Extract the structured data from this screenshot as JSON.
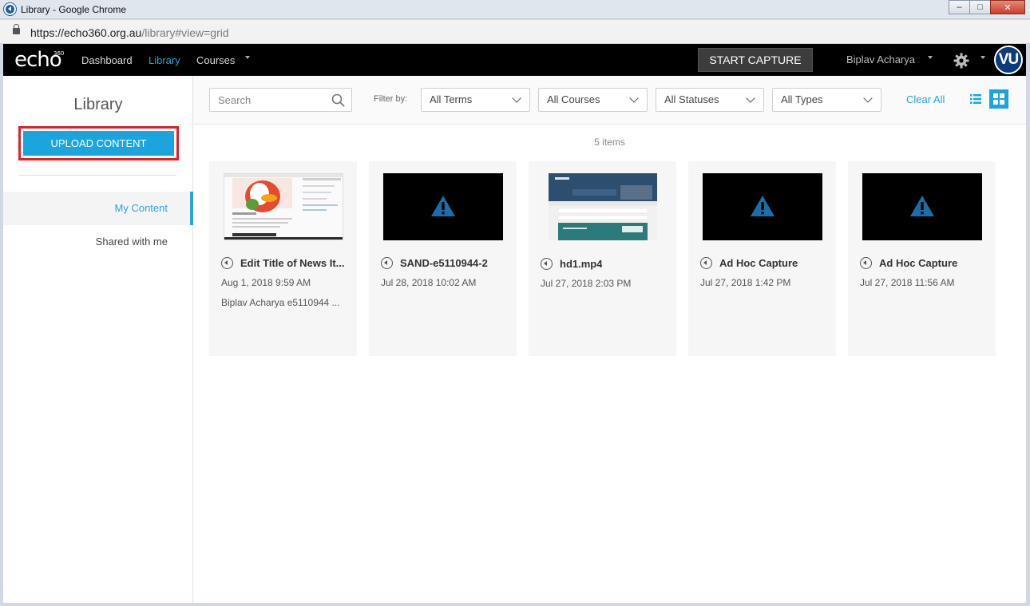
{
  "window": {
    "title": "Library - Google Chrome",
    "url_host": "https://echo360.org.au",
    "url_path": "/library#view=grid"
  },
  "nav": {
    "logo": "echo",
    "logo_sup": "360",
    "links": [
      "Dashboard",
      "Library",
      "Courses"
    ],
    "active": "Library",
    "start_capture": "START CAPTURE",
    "user_name": "Biplav Acharya",
    "avatar_text": "VU"
  },
  "sidebar": {
    "title": "Library",
    "upload_label": "UPLOAD CONTENT",
    "items": [
      {
        "label": "My Content",
        "active": true
      },
      {
        "label": "Shared with me",
        "active": false
      }
    ]
  },
  "toolbar": {
    "search_placeholder": "Search",
    "filter_label": "Filter by:",
    "filters": [
      "All Terms",
      "All Courses",
      "All Statuses",
      "All Types"
    ],
    "clear_all": "Clear All"
  },
  "content": {
    "count": "5 items",
    "items": [
      {
        "title": "Edit Title of News It...",
        "date": "Aug 1, 2018 9:59 AM",
        "owner": "Biplav Acharya e5110944 ...",
        "thumb": "screenshot"
      },
      {
        "title": "SAND-e5110944-2",
        "date": "Jul 28, 2018 10:02 AM",
        "owner": "",
        "thumb": "warning"
      },
      {
        "title": "hd1.mp4",
        "date": "Jul 27, 2018 2:03 PM",
        "owner": "",
        "thumb": "webpage"
      },
      {
        "title": "Ad Hoc Capture",
        "date": "Jul 27, 2018 1:42 PM",
        "owner": "",
        "thumb": "warning"
      },
      {
        "title": "Ad Hoc Capture",
        "date": "Jul 27, 2018 11:56 AM",
        "owner": "",
        "thumb": "warning"
      }
    ]
  },
  "colors": {
    "accent": "#1aa5dc",
    "highlight_border": "#e21f26",
    "nav_bg": "#000000"
  }
}
